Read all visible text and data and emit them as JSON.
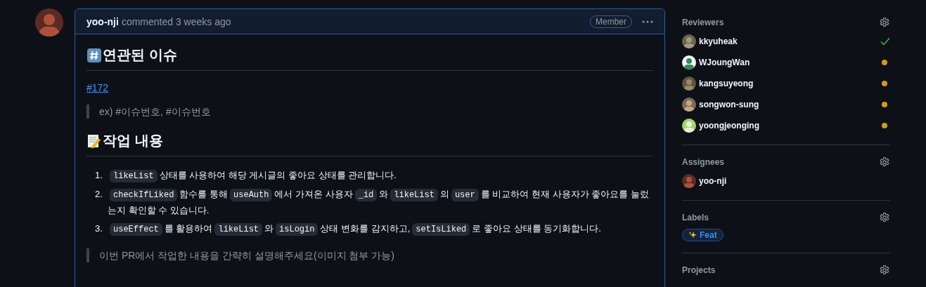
{
  "comment": {
    "author": "yoo-nji",
    "action": "commented 3 weeks ago",
    "badge": "Member",
    "sections": [
      {
        "kind": "heading",
        "text": "연관된 이슈"
      },
      {
        "kind": "link",
        "text": "#172"
      },
      {
        "kind": "quote",
        "text": "ex) #이슈번호, #이슈번호"
      },
      {
        "kind": "heading",
        "text": "작업 내용"
      },
      {
        "kind": "list",
        "items": [
          {
            "number": "1.",
            "parts": [
              {
                "kind": "code",
                "text": "likeList"
              },
              {
                "kind": "text",
                "text": "상태를 사용하여 해당 게시글의 좋아요 상태를 관리합니다."
              }
            ]
          },
          {
            "number": "2.",
            "parts": [
              {
                "kind": "code",
                "text": "checkIfLiked"
              },
              {
                "kind": "text",
                "text": "함수를 통해"
              },
              {
                "kind": "code",
                "text": "useAuth"
              },
              {
                "kind": "text",
                "text": "에서 가져온 사용자"
              },
              {
                "kind": "code",
                "text": "_id"
              },
              {
                "kind": "text",
                "text": "와"
              },
              {
                "kind": "code",
                "text": "likeList"
              },
              {
                "kind": "text",
                "text": "의"
              },
              {
                "kind": "code",
                "text": "user"
              },
              {
                "kind": "text",
                "text": "를 비교하여 현재 사용자가 좋아요를 눌렀는지 확인할 수 있습니다."
              }
            ]
          },
          {
            "number": "3.",
            "parts": [
              {
                "kind": "code",
                "text": "useEffect"
              },
              {
                "kind": "text",
                "text": "를 활용하여"
              },
              {
                "kind": "code",
                "text": "likeList"
              },
              {
                "kind": "text",
                "text": "와"
              },
              {
                "kind": "code",
                "text": "isLogin"
              },
              {
                "kind": "text",
                "text": "상태 변화를 감지하고,"
              },
              {
                "kind": "code",
                "text": "setIsLiked"
              },
              {
                "kind": "text",
                "text": "로 좋아요 상태를 동기화합니다."
              }
            ]
          }
        ]
      },
      {
        "kind": "quote",
        "text": "이번 PR에서 작업한 내용을 간략히 설명해주세요(이미지 첨부 가능)"
      }
    ]
  },
  "sidebar": {
    "reviewers": {
      "title": "Reviewers",
      "people": [
        {
          "name": "kkyuheak",
          "approved": true
        },
        {
          "name": "WJoungWan",
          "approved": false
        },
        {
          "name": "kangsuyeong",
          "approved": false
        },
        {
          "name": "songwon-sung",
          "approved": false
        },
        {
          "name": "yoongjeonging",
          "approved": false
        }
      ]
    },
    "assignees": {
      "title": "Assignees",
      "people": [
        {
          "name": "yoo-nji"
        }
      ]
    },
    "labels": {
      "title": "Labels",
      "items": [
        {
          "text": "Feat"
        }
      ]
    },
    "projects": {
      "title": "Projects"
    }
  }
}
